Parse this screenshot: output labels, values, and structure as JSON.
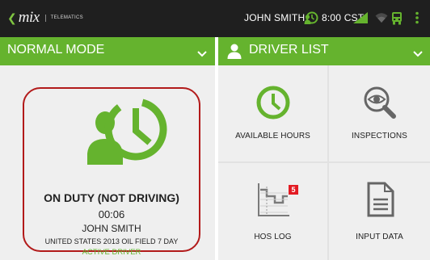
{
  "statusbar": {
    "logo_text": "mix",
    "logo_subtext": "TELEMATICS",
    "user_name": "JOHN SMITH",
    "time": "8:00 CST",
    "icons": [
      "clock-person-icon",
      "signal-icon",
      "wifi-icon",
      "truck-icon",
      "overflow-menu-icon"
    ]
  },
  "mode_bar": {
    "label": "NORMAL MODE"
  },
  "driver_bar": {
    "label": "DRIVER LIST"
  },
  "status_card": {
    "status": "ON DUTY (NOT DRIVING)",
    "elapsed": "00:06",
    "driver_name": "JOHN SMITH",
    "ruleset": "UNITED STATES 2013 OIL FIELD 7 DAY",
    "role": "ACTIVE DRIVER"
  },
  "tiles": [
    {
      "label": "AVAILABLE HOURS",
      "icon": "clock-icon"
    },
    {
      "label": "INSPECTIONS",
      "icon": "eye-magnifier-icon"
    },
    {
      "label": "HOS LOG",
      "icon": "hos-log-icon",
      "badge": "5"
    },
    {
      "label": "INPUT DATA",
      "icon": "document-icon"
    }
  ],
  "colors": {
    "accent_green": "#65b32e",
    "highlight_red": "#b21a1a",
    "badge_red": "#e31b23",
    "statusbar_bg": "#1f1f1f"
  }
}
